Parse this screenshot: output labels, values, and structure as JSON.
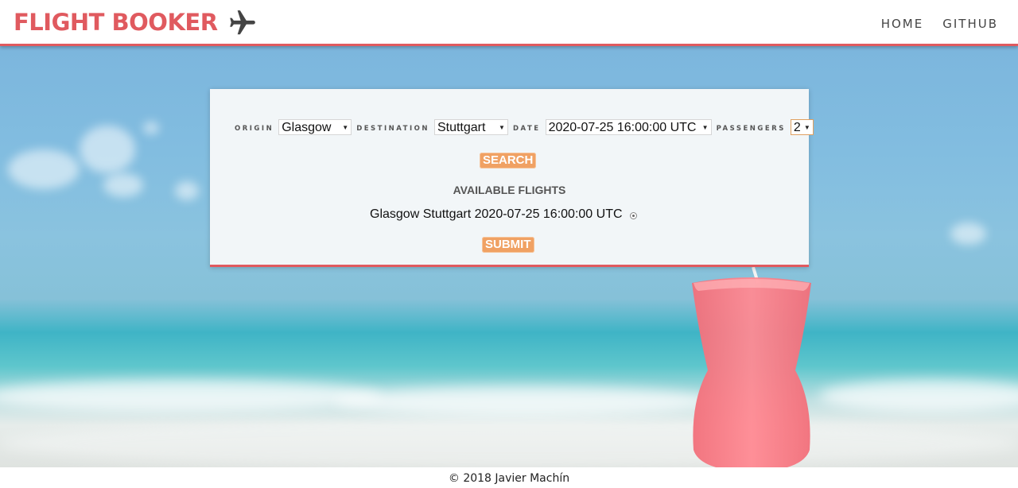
{
  "header": {
    "brand": "FLIGHT BOOKER",
    "nav": [
      "HOME",
      "GITHUB"
    ]
  },
  "form": {
    "origin_label": "ORIGIN",
    "origin_value": "Glasgow",
    "destination_label": "DESTINATION",
    "destination_value": "Stuttgart",
    "date_label": "DATE",
    "date_value": "2020-07-25 16:00:00 UTC",
    "passengers_label": "PASSENGERS",
    "passengers_value": "2",
    "search_label": "SEARCH"
  },
  "results": {
    "heading": "AVAILABLE FLIGHTS",
    "flights": [
      {
        "text": "Glasgow Stuttgart 2020-07-25 16:00:00 UTC"
      }
    ],
    "submit_label": "SUBMIT"
  },
  "footer": {
    "text": "© 2018 Javier Machín"
  },
  "colors": {
    "accent": "#e05a5f",
    "button": "#f0a163"
  },
  "icons": {
    "brand": "airplane-icon",
    "select_caret": "caret-down-icon",
    "radio": "radio-button-icon"
  }
}
